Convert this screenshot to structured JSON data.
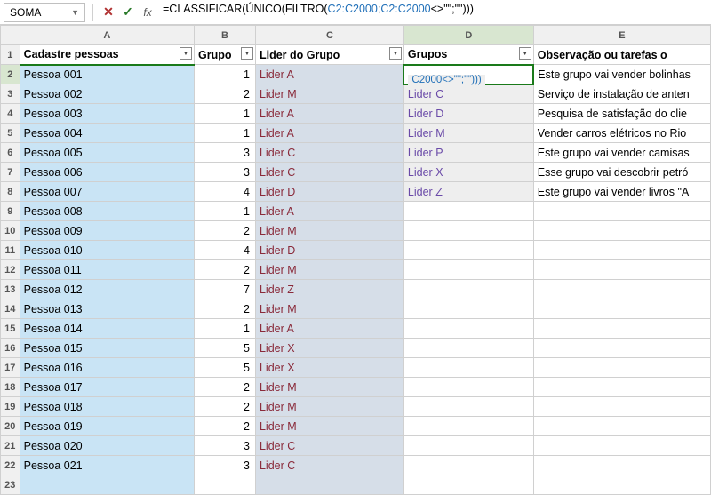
{
  "namebox": {
    "value": "SOMA"
  },
  "formula_parts": {
    "p1": "=CLASSIFICAR(ÚNICO(FILTRO(",
    "r1": "C2:C2000",
    "sep1": ";",
    "r2": "C2:C2000",
    "p2": "<>\"\";\"\")))"
  },
  "col_headers": [
    "A",
    "B",
    "C",
    "D",
    "E"
  ],
  "headers": {
    "A": "Cadastre pessoas",
    "B": "Grupo",
    "C": "Lider do Grupo",
    "D": "Grupos",
    "E": "Observação ou tarefas o"
  },
  "d2_text": "C2000<>\"\";\"\")))",
  "rows": [
    {
      "n": 2,
      "a": "Pessoa 001",
      "b": "1",
      "c": "Lider A",
      "d": "",
      "e": "Este grupo vai vender bolinhas"
    },
    {
      "n": 3,
      "a": "Pessoa 002",
      "b": "2",
      "c": "Lider M",
      "d": "Lider C",
      "e": "Serviço de instalação de anten"
    },
    {
      "n": 4,
      "a": "Pessoa 003",
      "b": "1",
      "c": "Lider A",
      "d": "Lider D",
      "e": "Pesquisa de satisfação do clie"
    },
    {
      "n": 5,
      "a": "Pessoa 004",
      "b": "1",
      "c": "Lider A",
      "d": "Lider M",
      "e": "Vender carros elétricos no Rio"
    },
    {
      "n": 6,
      "a": "Pessoa 005",
      "b": "3",
      "c": "Lider C",
      "d": "Lider P",
      "e": "Este grupo vai vender camisas"
    },
    {
      "n": 7,
      "a": "Pessoa 006",
      "b": "3",
      "c": "Lider C",
      "d": "Lider X",
      "e": "Esse grupo vai descobrir petró"
    },
    {
      "n": 8,
      "a": "Pessoa 007",
      "b": "4",
      "c": "Lider D",
      "d": "Lider Z",
      "e": "Este grupo vai vender livros \"A"
    },
    {
      "n": 9,
      "a": "Pessoa 008",
      "b": "1",
      "c": "Lider A",
      "d": "",
      "e": ""
    },
    {
      "n": 10,
      "a": "Pessoa 009",
      "b": "2",
      "c": "Lider M",
      "d": "",
      "e": ""
    },
    {
      "n": 11,
      "a": "Pessoa 010",
      "b": "4",
      "c": "Lider D",
      "d": "",
      "e": ""
    },
    {
      "n": 12,
      "a": "Pessoa 011",
      "b": "2",
      "c": "Lider M",
      "d": "",
      "e": ""
    },
    {
      "n": 13,
      "a": "Pessoa 012",
      "b": "7",
      "c": "Lider Z",
      "d": "",
      "e": ""
    },
    {
      "n": 14,
      "a": "Pessoa 013",
      "b": "2",
      "c": "Lider M",
      "d": "",
      "e": ""
    },
    {
      "n": 15,
      "a": "Pessoa 014",
      "b": "1",
      "c": "Lider A",
      "d": "",
      "e": ""
    },
    {
      "n": 16,
      "a": "Pessoa 015",
      "b": "5",
      "c": "Lider X",
      "d": "",
      "e": ""
    },
    {
      "n": 17,
      "a": "Pessoa 016",
      "b": "5",
      "c": "Lider X",
      "d": "",
      "e": ""
    },
    {
      "n": 18,
      "a": "Pessoa 017",
      "b": "2",
      "c": "Lider M",
      "d": "",
      "e": ""
    },
    {
      "n": 19,
      "a": "Pessoa 018",
      "b": "2",
      "c": "Lider M",
      "d": "",
      "e": ""
    },
    {
      "n": 20,
      "a": "Pessoa 019",
      "b": "2",
      "c": "Lider M",
      "d": "",
      "e": ""
    },
    {
      "n": 21,
      "a": "Pessoa 020",
      "b": "3",
      "c": "Lider C",
      "d": "",
      "e": ""
    },
    {
      "n": 22,
      "a": "Pessoa 021",
      "b": "3",
      "c": "Lider C",
      "d": "",
      "e": ""
    },
    {
      "n": 23,
      "a": "",
      "b": "",
      "c": "",
      "d": "",
      "e": ""
    }
  ]
}
